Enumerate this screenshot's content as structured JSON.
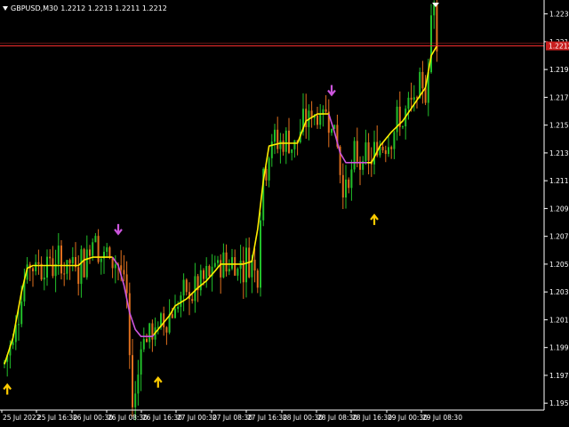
{
  "header": {
    "symbol": "GBPUSD,M30",
    "prices": "1.2212 1.2213 1.2211 1.2212"
  },
  "colors": {
    "background": "#000000",
    "axis": "#ffffff",
    "bull_candle": "#22c02a",
    "bear_candle": "#e0701e",
    "ma_main": "#ffee00",
    "ma_down": "#cc55dd",
    "arrow_buy": "#ffcc00",
    "arrow_sell": "#cc55dd",
    "bid_line": "#ff3030",
    "price_box": "#c81e1e"
  },
  "price_axis": {
    "labels": [
      "1.2235",
      "1.2215",
      "1.2195",
      "1.2175",
      "1.2155",
      "1.2135",
      "1.2115",
      "1.2095",
      "1.2075",
      "1.2055",
      "1.2035",
      "1.2015",
      "1.1995",
      "1.1975",
      "1.1955"
    ],
    "current_price": "1.2212"
  },
  "time_axis": {
    "labels": [
      "25 Jul 2022",
      "25 Jul 16:30",
      "26 Jul 00:30",
      "26 Jul 08:30",
      "26 Jul 16:30",
      "27 Jul 00:30",
      "27 Jul 08:30",
      "27 Jul 16:30",
      "28 Jul 00:30",
      "28 Jul 08:30",
      "28 Jul 16:30",
      "29 Jul 00:30",
      "29 Jul 08:30"
    ]
  },
  "chart_data": {
    "type": "candlestick",
    "symbol": "GBPUSD",
    "timeframe": "M30",
    "ylim": [
      1.195,
      1.2245
    ],
    "current_price": 1.2212,
    "ma_path": [
      [
        0,
        1.1983
      ],
      [
        3,
        1.2002
      ],
      [
        6,
        1.2035
      ],
      [
        8,
        1.2052
      ],
      [
        10,
        1.2054
      ],
      [
        14,
        1.2054
      ],
      [
        18,
        1.2054
      ],
      [
        22,
        1.2054
      ],
      [
        26,
        1.2054
      ],
      [
        28,
        1.2058
      ],
      [
        31,
        1.206
      ],
      [
        36,
        1.206
      ],
      [
        38,
        1.206
      ],
      [
        40,
        1.2054
      ],
      [
        42,
        1.204
      ],
      [
        44,
        1.202
      ],
      [
        46,
        1.2008
      ],
      [
        48,
        1.2003
      ],
      [
        50,
        1.2003
      ],
      [
        52,
        1.2003
      ],
      [
        54,
        1.2008
      ],
      [
        58,
        1.2018
      ],
      [
        60,
        1.2025
      ],
      [
        64,
        1.203
      ],
      [
        68,
        1.2038
      ],
      [
        71,
        1.2043
      ],
      [
        74,
        1.205
      ],
      [
        76,
        1.2055
      ],
      [
        80,
        1.2055
      ],
      [
        84,
        1.2055
      ],
      [
        87,
        1.2057
      ],
      [
        89,
        1.208
      ],
      [
        91,
        1.2115
      ],
      [
        93,
        1.214
      ],
      [
        97,
        1.2142
      ],
      [
        103,
        1.2142
      ],
      [
        106,
        1.2158
      ],
      [
        110,
        1.2163
      ],
      [
        114,
        1.2163
      ],
      [
        116,
        1.215
      ],
      [
        118,
        1.2135
      ],
      [
        120,
        1.2128
      ],
      [
        122,
        1.2128
      ],
      [
        127,
        1.2128
      ],
      [
        129,
        1.2128
      ],
      [
        132,
        1.214
      ],
      [
        136,
        1.215
      ],
      [
        140,
        1.2158
      ],
      [
        144,
        1.217
      ],
      [
        148,
        1.2182
      ],
      [
        150,
        1.2205
      ],
      [
        152,
        1.2212
      ]
    ],
    "ma_down_ranges": [
      [
        38,
        52
      ],
      [
        114,
        127
      ]
    ],
    "signals": [
      {
        "type": "buy",
        "index": 1,
        "price": 1.1965
      },
      {
        "type": "sell",
        "index": 40,
        "price": 1.208
      },
      {
        "type": "buy",
        "index": 54,
        "price": 1.197
      },
      {
        "type": "sell",
        "index": 115,
        "price": 1.218
      },
      {
        "type": "buy",
        "index": 130,
        "price": 1.2087
      }
    ]
  }
}
